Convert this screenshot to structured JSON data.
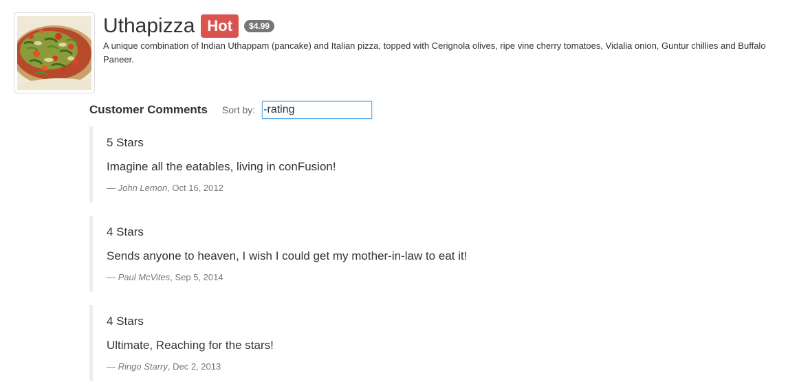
{
  "dish": {
    "name": "Uthapizza",
    "label": "Hot",
    "price": "$4.99",
    "description": "A unique combination of Indian Uthappam (pancake) and Italian pizza, topped with Cerignola olives, ripe vine cherry tomatoes, Vidalia onion, Guntur chillies and Buffalo Paneer.",
    "image_icon": "pizza-image"
  },
  "comments_section": {
    "title": "Customer Comments",
    "sort_label": "Sort by:",
    "sort_value": "-rating"
  },
  "comments": [
    {
      "rating": "5 Stars",
      "text": "Imagine all the eatables, living in conFusion!",
      "dash": "—",
      "author": "John Lemon",
      "date": ", Oct 16, 2012"
    },
    {
      "rating": "4 Stars",
      "text": "Sends anyone to heaven, I wish I could get my mother-in-law to eat it!",
      "dash": "—",
      "author": "Paul McVites",
      "date": ", Sep 5, 2014"
    },
    {
      "rating": "4 Stars",
      "text": "Ultimate, Reaching for the stars!",
      "dash": "—",
      "author": "Ringo Starry",
      "date": ", Dec 2, 2013"
    }
  ],
  "colors": {
    "hot": "#d9534f",
    "badge": "#777777",
    "input_focus": "#66afe9",
    "quote_border": "#eeeeee"
  }
}
